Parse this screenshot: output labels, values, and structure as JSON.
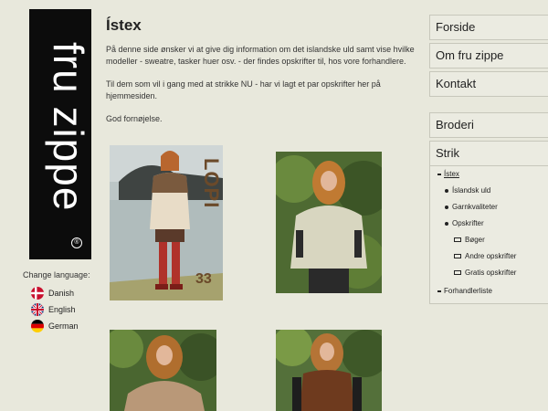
{
  "logo": {
    "text": "fru zippe"
  },
  "language": {
    "title": "Change language:",
    "items": [
      {
        "label": "Danish",
        "flag": "denmark-flag-icon"
      },
      {
        "label": "English",
        "flag": "uk-flag-icon"
      },
      {
        "label": "German",
        "flag": "germany-flag-icon"
      }
    ]
  },
  "main": {
    "title": "Ístex",
    "paragraphs": [
      "På denne side ønsker vi at give dig information om det islandske uld samt vise hvilke modeller -  sweatre, tasker huer osv. - der findes opskrifter til, hos vore forhandlere.",
      "Til dem som vil i gang med at strikke NU - har vi lagt et par opskrifter her på hjemmesiden.",
      "God fornøjelse."
    ],
    "cover": {
      "brand": "LOPI",
      "issue": "33"
    }
  },
  "nav": {
    "items": [
      "Forside",
      "Om fru zippe",
      "Kontakt"
    ],
    "broderi": "Broderi",
    "strik": {
      "label": "Strik",
      "istex": "Ístex",
      "level2": [
        "Íslandsk uld",
        "Garnkvaliteter",
        "Opskrifter"
      ],
      "level3": [
        "Bøger",
        "Andre opskrifter",
        "Gratis opskrifter"
      ],
      "forhandler": "Forhandlerliste"
    }
  },
  "colors": {
    "background": "#e8e8dc",
    "logo_bg": "#0c0c0c",
    "nav_bg": "#ebebe1"
  }
}
